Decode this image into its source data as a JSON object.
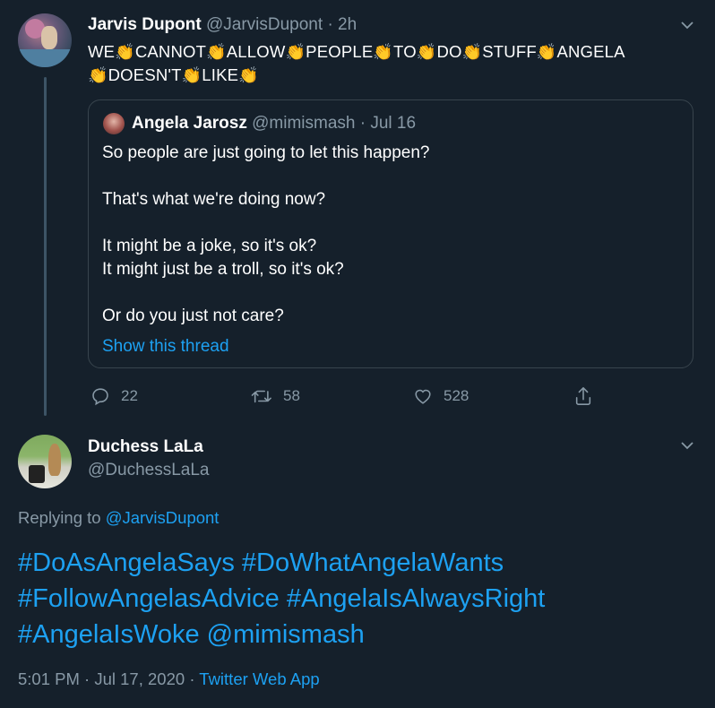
{
  "colors": {
    "background": "#15202b",
    "text": "#ffffff",
    "muted": "#8899a6",
    "link": "#1da1f2",
    "border": "#38444d"
  },
  "tweet1": {
    "name": "Jarvis Dupont",
    "handle": "@JarvisDupont",
    "sep": "·",
    "time": "2h",
    "words_line1": [
      "WE",
      "CANNOT",
      "ALLOW",
      "PEOPLE",
      "TO",
      "DO",
      "STUFF",
      "ANGELA"
    ],
    "words_line2": [
      "DOESN'T",
      "LIKE"
    ],
    "clap_emoji": "👏",
    "quote": {
      "name": "Angela Jarosz",
      "handle": "@mimismash",
      "sep": "·",
      "date": "Jul 16",
      "lines": [
        "So people are just going to let this happen?",
        "That's what we're doing now?",
        "It might be a joke, so it's ok?",
        "It might just be a troll, so it's ok?",
        "Or do you just not care?"
      ],
      "show_thread": "Show this thread"
    },
    "actions": {
      "replies": "22",
      "retweets": "58",
      "likes": "528"
    }
  },
  "tweet2": {
    "name": "Duchess LaLa",
    "handle": "@DuchessLaLa",
    "replying_prefix": "Replying to",
    "replying_to": "@JarvisDupont",
    "text_line1": "#DoAsAngelaSays #DoWhatAngelaWants",
    "text_line2": "#FollowAngelasAdvice #AngelaIsAlwaysRight",
    "text_line3": "#AngelaIsWoke @mimismash",
    "time": "5:01 PM",
    "sep1": "·",
    "date": "Jul 17, 2020",
    "sep2": "·",
    "source": "Twitter Web App"
  },
  "icons": {
    "more": "chevron-down-icon",
    "reply": "reply-icon",
    "retweet": "retweet-icon",
    "like": "heart-icon",
    "share": "share-icon"
  }
}
